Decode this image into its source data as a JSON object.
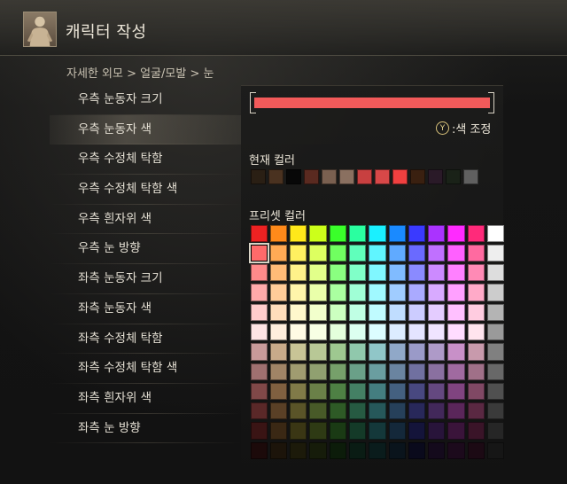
{
  "header": {
    "title": "캐릭터 작성",
    "avatar_icon": "character-portrait-icon"
  },
  "breadcrumb": "자세한 외모 > 얼굴/모발 > 눈",
  "menu": {
    "items": [
      {
        "label": "우측 눈동자 크기"
      },
      {
        "label": "우측 눈동자 색"
      },
      {
        "label": "우측 수정체 탁함"
      },
      {
        "label": "우측 수정체 탁함 색"
      },
      {
        "label": "우측 흰자위 색"
      },
      {
        "label": "우측 눈 방향"
      },
      {
        "label": "좌측 눈동자 크기"
      },
      {
        "label": "좌측 눈동자 색"
      },
      {
        "label": "좌측 수정체 탁함"
      },
      {
        "label": "좌측 수정체 탁함 색"
      },
      {
        "label": "좌측 흰자위 색"
      },
      {
        "label": "좌측 눈 방향"
      }
    ],
    "selected_index": 1
  },
  "panel": {
    "current_color": "#f25a5a",
    "adjust_button_glyph": "Y",
    "adjust_label": ":색 조정",
    "current_section_label": "현재 컬러",
    "preset_section_label": "프리셋 컬러",
    "current_swatches": [
      "#2a1f14",
      "#4a3220",
      "#080808",
      "#5a2a20",
      "#7a6050",
      "#8a7060",
      "#c84040",
      "#d84848",
      "#f04040",
      "#3a2010",
      "#2a1a28",
      "#1a2218",
      "#606060"
    ],
    "preset_selected": {
      "row": 1,
      "col": 0
    },
    "preset_colors": [
      [
        "#ee2222",
        "#ff8a1a",
        "#ffe81a",
        "#ccff1a",
        "#3aff2a",
        "#2affa0",
        "#1af0ff",
        "#1a8aff",
        "#3a3aff",
        "#aa33ff",
        "#ff2aff",
        "#ff2a7a",
        "#ffffff"
      ],
      [
        "#ff6a6a",
        "#ffaa55",
        "#fff060",
        "#ddff60",
        "#70ff60",
        "#60ffbb",
        "#60f5ff",
        "#60aaff",
        "#6a6aff",
        "#c070ff",
        "#ff60ff",
        "#ff6aa0",
        "#eeeeee"
      ],
      [
        "#ff8a8a",
        "#ffbb77",
        "#fff28a",
        "#e2ff8a",
        "#8aff80",
        "#80ffc8",
        "#80f7ff",
        "#80bbff",
        "#8a8aff",
        "#cc8aff",
        "#ff80ff",
        "#ff8ab5",
        "#dddddd"
      ],
      [
        "#ffaaaa",
        "#ffcc99",
        "#fff5aa",
        "#eaffaa",
        "#aaffa0",
        "#a0ffd6",
        "#a0f9ff",
        "#a0ccff",
        "#aaaaff",
        "#d8aaff",
        "#ffa0ff",
        "#ffaac8",
        "#cccccc"
      ],
      [
        "#ffcccc",
        "#ffddbb",
        "#fff8cc",
        "#f2ffcc",
        "#ccffc0",
        "#c0ffe4",
        "#c0fbff",
        "#c0ddff",
        "#ccccff",
        "#e4ccff",
        "#ffc0ff",
        "#ffcce0",
        "#b4b4b4"
      ],
      [
        "#ffe4e4",
        "#ffeedd",
        "#fffbe4",
        "#f8ffe4",
        "#e4ffdc",
        "#dcfff0",
        "#dcfdff",
        "#dcecff",
        "#e4e4ff",
        "#f0e4ff",
        "#ffdcff",
        "#ffe4ee",
        "#9a9a9a"
      ],
      [
        "#c89a9a",
        "#c8aa8a",
        "#c8c496",
        "#b8c896",
        "#9ec890",
        "#90c8ac",
        "#90c6c8",
        "#90a8c8",
        "#9a9ac8",
        "#ae9ac8",
        "#c890c8",
        "#c89aac",
        "#808080"
      ],
      [
        "#a07070",
        "#a08466",
        "#a09c70",
        "#90a070",
        "#76a06a",
        "#6aa088",
        "#6a9ea0",
        "#6a84a0",
        "#7070a0",
        "#8a70a0",
        "#a06aa0",
        "#a07088",
        "#686868"
      ],
      [
        "#804848",
        "#806040",
        "#807a48",
        "#6a8048",
        "#4e8044",
        "#448064",
        "#447e80",
        "#446080",
        "#484880",
        "#644880",
        "#804480",
        "#804864",
        "#505050"
      ],
      [
        "#5a2828",
        "#5a4026",
        "#5a5428",
        "#485a28",
        "#2e5a26",
        "#265a42",
        "#26585a",
        "#26405a",
        "#28285a",
        "#42285a",
        "#5a265a",
        "#5a2842",
        "#3a3a3a"
      ],
      [
        "#3a1414",
        "#3a2814",
        "#3a3614",
        "#2e3a14",
        "#1a3a14",
        "#143a28",
        "#14383a",
        "#14283a",
        "#14143a",
        "#28143a",
        "#3a143a",
        "#3a1428",
        "#262626"
      ],
      [
        "#1c0a0a",
        "#1c140a",
        "#1c1a0a",
        "#161c0a",
        "#0c1c0a",
        "#0a1c14",
        "#0a1c1c",
        "#0a141c",
        "#0a0a1c",
        "#140a1c",
        "#1c0a1c",
        "#1c0a14",
        "#161616"
      ]
    ]
  }
}
